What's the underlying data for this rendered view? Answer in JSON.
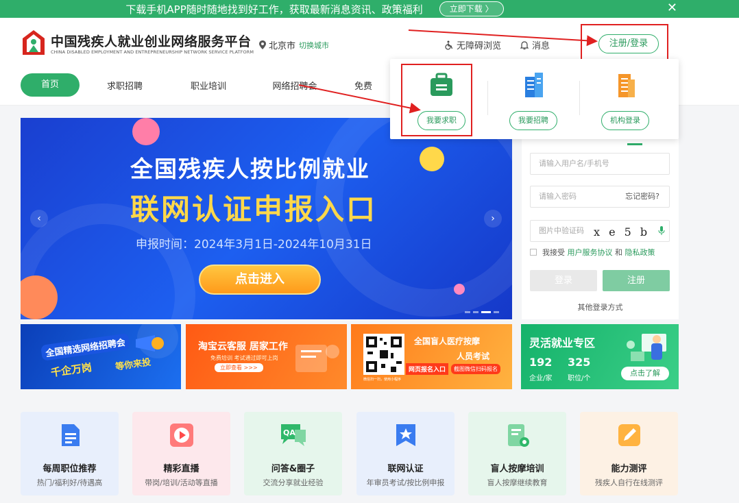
{
  "promo": {
    "text": "下载手机APP随时随地找到好工作，获取最新消息资讯、政策福利",
    "download_label": "立即下载 〉",
    "close": "✕"
  },
  "header": {
    "title": "中国残疾人就业创业网络服务平台",
    "subtitle": "CHINA DISABLED EMPLOYMENT AND ENTREPRENEURSHIP NETWORK SERVICE PLATFORM",
    "city": "北京市",
    "switch_city": "切换城市",
    "accessibility": "无障碍浏览",
    "messages": "消息",
    "login_register": "注册/登录"
  },
  "nav": {
    "items": [
      "首页",
      "求职招聘",
      "职业培训",
      "网络招聘会",
      "免费"
    ]
  },
  "popup": {
    "job_seek": "我要求职",
    "recruit": "我要招聘",
    "org_login": "机构登录"
  },
  "banner": {
    "line1": "全国残疾人按比例就业",
    "line2": "联网认证申报入口",
    "line3": "申报时间：2024年3月1日-2024年10月31日",
    "enter": "点击进入",
    "prev": "‹",
    "next": "›"
  },
  "login": {
    "username_placeholder": "请输入用户名/手机号",
    "password_placeholder": "请输入密码",
    "forgot": "忘记密码?",
    "captcha_placeholder": "图片中验证码",
    "captcha_text": "x e 5 b",
    "agree_prefix": "我接受",
    "agree_terms": "用户服务协议",
    "agree_and": "和",
    "agree_privacy": "隐私政策",
    "login_btn": "登录",
    "register_btn": "注册",
    "other": "其他登录方式"
  },
  "ads": {
    "ad1": {
      "t1": "全国精选网络招聘会",
      "t2": "千企万岗",
      "t3": "等你来投"
    },
    "ad2": {
      "t1": "淘宝云客服  居家工作",
      "t2": "免费培训  考试通过即可上岗",
      "t3": "立即查看 >>>"
    },
    "ad3": {
      "t1": "全国盲人医疗按摩",
      "t2": "人员考试",
      "t3": "网页报名入口",
      "t4": "截图微信扫码报名",
      "qr_caption": "微信扫一扫，使用小程序"
    },
    "ad4": {
      "title": "灵活就业专区",
      "n1": "192",
      "n2": "325",
      "u1": "企业/家",
      "u2": "职位/个",
      "learn": "点击了解"
    }
  },
  "features": [
    {
      "title": "每周职位推荐",
      "desc": "热门/福利好/待遇高"
    },
    {
      "title": "精彩直播",
      "desc": "带岗/培训/活动等直播"
    },
    {
      "title": "问答&圈子",
      "desc": "交流分享就业经验"
    },
    {
      "title": "联网认证",
      "desc": "年审员考试/按比例申报"
    },
    {
      "title": "盲人按摩培训",
      "desc": "盲人按摩继续教育"
    },
    {
      "title": "能力测评",
      "desc": "残疾人自行在线测评"
    }
  ],
  "colors": {
    "brand_green": "#2fae6a",
    "annotation_red": "#e02020",
    "banner_blue": "#1d5ff0"
  }
}
